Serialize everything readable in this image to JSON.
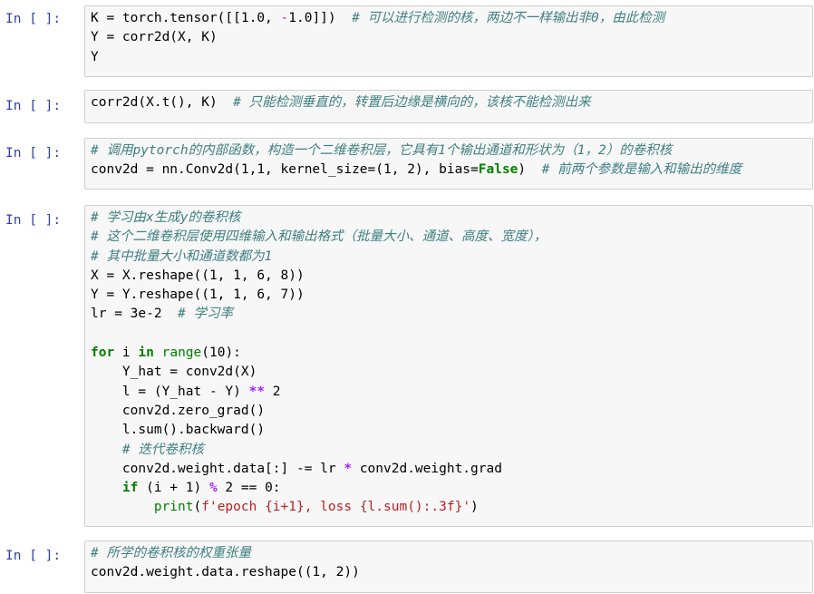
{
  "notebook": {
    "prompt_label": "In [ ]:",
    "cells": [
      {
        "lines": [
          [
            {
              "t": "K = torch.tensor([[1.0, ",
              "c": "text"
            },
            {
              "t": "-",
              "c": "opn"
            },
            {
              "t": "1.0]])  ",
              "c": "text"
            },
            {
              "t": "# 可以进行检测的核，两边不一样输出非0，由此检测",
              "c": "comment"
            }
          ],
          [
            {
              "t": "Y = corr2d(X, K)",
              "c": "text"
            }
          ],
          [
            {
              "t": "Y",
              "c": "text"
            }
          ]
        ]
      },
      {
        "lines": [
          [
            {
              "t": "corr2d(X.t(), K)  ",
              "c": "text"
            },
            {
              "t": "# 只能检测垂直的，转置后边缘是横向的，该核不能检测出来",
              "c": "comment"
            }
          ]
        ]
      },
      {
        "lines": [
          [
            {
              "t": "# 调用pytorch的内部函数，构造一个二维卷积层，它具有1个输出通道和形状为（1，2）的卷积核",
              "c": "comment"
            }
          ],
          [
            {
              "t": "conv2d = nn.Conv2d(1,1, kernel_size=(1, 2), bias=",
              "c": "text"
            },
            {
              "t": "False",
              "c": "kw"
            },
            {
              "t": ")  ",
              "c": "text"
            },
            {
              "t": "# 前两个参数是输入和输出的维度",
              "c": "comment"
            }
          ]
        ]
      },
      {
        "lines": [
          [
            {
              "t": "# 学习由x生成y的卷积核",
              "c": "comment"
            }
          ],
          [
            {
              "t": "# 这个二维卷积层使用四维输入和输出格式（批量大小、通道、高度、宽度），",
              "c": "comment"
            }
          ],
          [
            {
              "t": "# 其中批量大小和通道数都为1",
              "c": "comment"
            }
          ],
          [
            {
              "t": "X = X.reshape((1, 1, 6, 8))",
              "c": "text"
            }
          ],
          [
            {
              "t": "Y = Y.reshape((1, 1, 6, 7))",
              "c": "text"
            }
          ],
          [
            {
              "t": "lr = 3e-2  ",
              "c": "text"
            },
            {
              "t": "# 学习率",
              "c": "comment"
            }
          ],
          [
            {
              "t": "",
              "c": "text"
            }
          ],
          [
            {
              "t": "for",
              "c": "kw"
            },
            {
              "t": " i ",
              "c": "text"
            },
            {
              "t": "in",
              "c": "kw"
            },
            {
              "t": " ",
              "c": "text"
            },
            {
              "t": "range",
              "c": "builtin"
            },
            {
              "t": "(10):",
              "c": "text"
            }
          ],
          [
            {
              "t": "    Y_hat = conv2d(X)",
              "c": "text"
            }
          ],
          [
            {
              "t": "    l = (Y_hat - Y) ",
              "c": "text"
            },
            {
              "t": "**",
              "c": "op"
            },
            {
              "t": " 2",
              "c": "text"
            }
          ],
          [
            {
              "t": "    conv2d.zero_grad()",
              "c": "text"
            }
          ],
          [
            {
              "t": "    l.sum().backward()",
              "c": "text"
            }
          ],
          [
            {
              "t": "    ",
              "c": "text"
            },
            {
              "t": "# 迭代卷积核",
              "c": "comment"
            }
          ],
          [
            {
              "t": "    conv2d.weight.data[:] -= lr ",
              "c": "text"
            },
            {
              "t": "*",
              "c": "op"
            },
            {
              "t": " conv2d.weight.grad",
              "c": "text"
            }
          ],
          [
            {
              "t": "    ",
              "c": "text"
            },
            {
              "t": "if",
              "c": "kw"
            },
            {
              "t": " (i + 1) ",
              "c": "text"
            },
            {
              "t": "%",
              "c": "op"
            },
            {
              "t": " 2 == 0:",
              "c": "text"
            }
          ],
          [
            {
              "t": "        ",
              "c": "text"
            },
            {
              "t": "print",
              "c": "builtin"
            },
            {
              "t": "(",
              "c": "text"
            },
            {
              "t": "f'epoch {i+1}, loss {l.sum():.3f}'",
              "c": "str"
            },
            {
              "t": ")",
              "c": "text"
            }
          ]
        ]
      },
      {
        "lines": [
          [
            {
              "t": "# 所学的卷积核的权重张量",
              "c": "comment"
            }
          ],
          [
            {
              "t": "conv2d.weight.data.reshape((1, 2))",
              "c": "text"
            }
          ]
        ]
      }
    ]
  }
}
